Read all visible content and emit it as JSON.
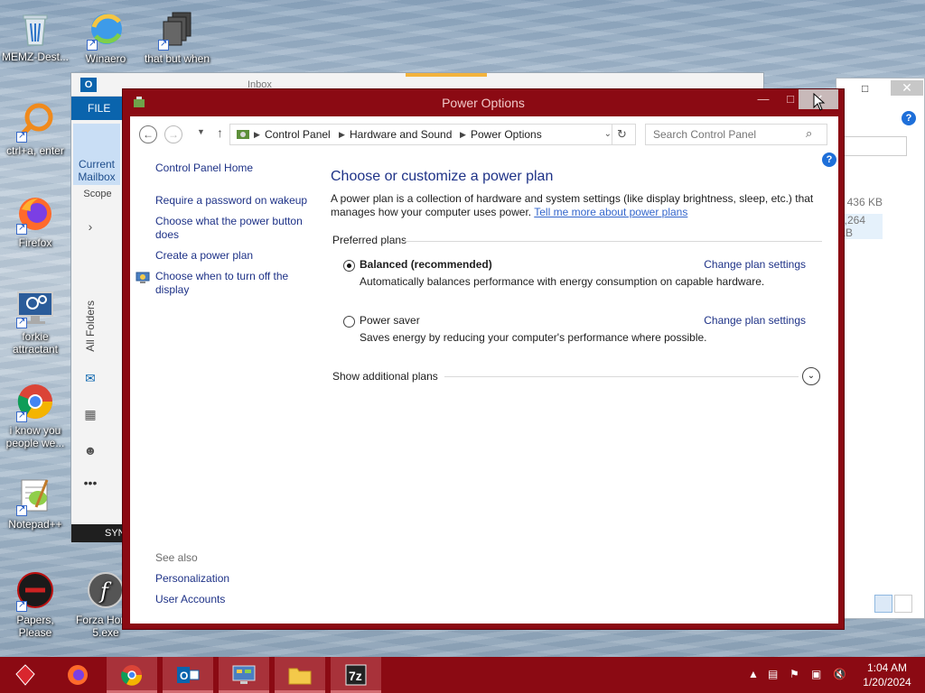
{
  "desktop": {
    "icons": [
      {
        "label": "MEMZ-Dest..."
      },
      {
        "label": "Winaero"
      },
      {
        "label": "that but when"
      },
      {
        "label": "ctrl+a, enter"
      },
      {
        "label": "Firefox"
      },
      {
        "label": "forkie attractant"
      },
      {
        "label": "i know you people we..."
      },
      {
        "label": "Notepad++"
      },
      {
        "label": "Papers, Please"
      },
      {
        "label": "Forza Hori... 5.exe"
      }
    ]
  },
  "outlook": {
    "ribbon_tab": "FILE",
    "inbox_label": "Inbox",
    "current_mailbox": "Current Mailbox",
    "scope": "Scope",
    "all_folders": "All Folders",
    "status_bar": "SYN"
  },
  "explorer": {
    "size1": "436 KB",
    "size2": "9,264 KB"
  },
  "power_options": {
    "title": "Power Options",
    "address": {
      "crumbs": [
        "Control Panel",
        "Hardware and Sound",
        "Power Options"
      ],
      "search_placeholder": "Search Control Panel"
    },
    "sidebar": {
      "home": "Control Panel Home",
      "links": [
        "Require a password on wakeup",
        "Choose what the power button does",
        "Create a power plan",
        "Choose when to turn off the display"
      ],
      "see_also": "See also",
      "see_also_links": [
        "Personalization",
        "User Accounts"
      ]
    },
    "main": {
      "heading": "Choose or customize a power plan",
      "description": "A power plan is a collection of hardware and system settings (like display brightness, sleep, etc.) that manages how your computer uses power.",
      "tell_more": "Tell me more about power plans",
      "preferred_plans": "Preferred plans",
      "plans": [
        {
          "name": "Balanced (recommended)",
          "description": "Automatically balances performance with energy consumption on capable hardware.",
          "change": "Change plan settings",
          "selected": true
        },
        {
          "name": "Power saver",
          "description": "Saves energy by reducing your computer's performance where possible.",
          "change": "Change plan settings",
          "selected": false
        }
      ],
      "show_additional": "Show additional plans"
    }
  },
  "taskbar": {
    "time": "1:04 AM",
    "date": "1/20/2024",
    "apps": [
      "start-orb",
      "firefox",
      "chrome",
      "outlook",
      "control-panel",
      "file-explorer",
      "7-zip"
    ]
  },
  "colors": {
    "window_frame": "#8b0a13",
    "link": "#1e3287",
    "heading": "#1e3287"
  }
}
